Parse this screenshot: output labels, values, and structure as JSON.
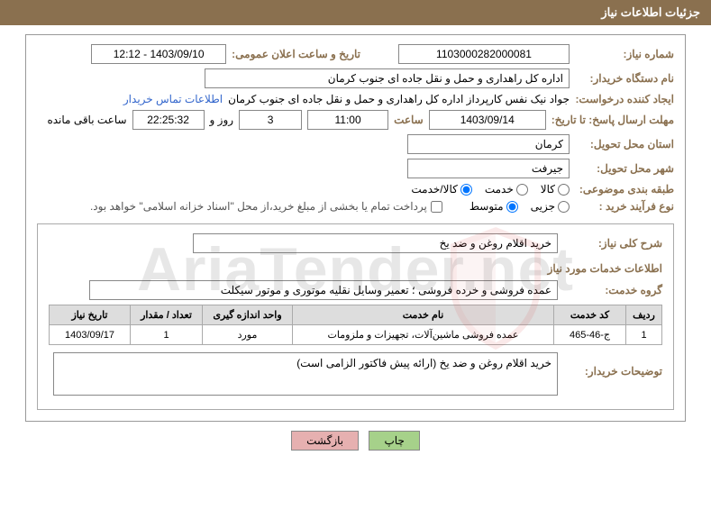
{
  "header": {
    "title": "جزئیات اطلاعات نیاز"
  },
  "need_number_label": "شماره نیاز:",
  "need_number": "1103000282000081",
  "announce_label": "تاریخ و ساعت اعلان عمومی:",
  "announce_value": "1403/09/10 - 12:12",
  "buyer_org_label": "نام دستگاه خریدار:",
  "buyer_org": "اداره کل راهداری و حمل و نقل جاده ای جنوب کرمان",
  "requester_label": "ایجاد کننده درخواست:",
  "requester": "جواد  نیک نفس کارپرداز اداره کل راهداری و حمل و نقل جاده ای جنوب کرمان",
  "contact_link": "اطلاعات تماس خریدار",
  "deadline_label": "مهلت ارسال پاسخ: تا تاریخ:",
  "deadline_date": "1403/09/14",
  "deadline_time_label": "ساعت",
  "deadline_time": "11:00",
  "days_value": "3",
  "days_and_label": "روز و",
  "countdown": "22:25:32",
  "countdown_label": "ساعت باقی مانده",
  "province_label": "استان محل تحویل:",
  "province": "کرمان",
  "city_label": "شهر محل تحویل:",
  "city": "جیرفت",
  "category_label": "طبقه بندی موضوعی:",
  "cat_kala": "کالا",
  "cat_khadamat": "خدمت",
  "cat_kala_khadmat": "کالا/خدمت",
  "process_label": "نوع فرآیند خرید :",
  "process_partial": "جزیی",
  "process_medium": "متوسط",
  "payment_note": "پرداخت تمام یا بخشی از مبلغ خرید،از محل \"اسناد خزانه اسلامی\" خواهد بود.",
  "desc_label": "شرح کلی نیاز:",
  "desc_value": "خرید اقلام روغن و ضد یخ",
  "services_section_title": "اطلاعات خدمات مورد نیاز",
  "service_group_label": "گروه خدمت:",
  "service_group": "عمده فروشی و خرده فروشی ؛ تعمیر وسایل نقلیه موتوری و موتور سیکلت",
  "table": {
    "headers": [
      "ردیف",
      "کد خدمت",
      "نام خدمت",
      "واحد اندازه گیری",
      "تعداد / مقدار",
      "تاریخ نیاز"
    ],
    "row": [
      "1",
      "ج-46-465",
      "عمده فروشی ماشین‌آلات، تجهیزات و ملزومات",
      "مورد",
      "1",
      "1403/09/17"
    ]
  },
  "buyer_notes_label": "توضیحات خریدار:",
  "buyer_notes": "خرید اقلام روغن و ضد یخ (ارائه پیش فاکتور الزامی است)",
  "buttons": {
    "print": "چاپ",
    "back": "بازگشت"
  },
  "watermark": "AriaTender.net"
}
